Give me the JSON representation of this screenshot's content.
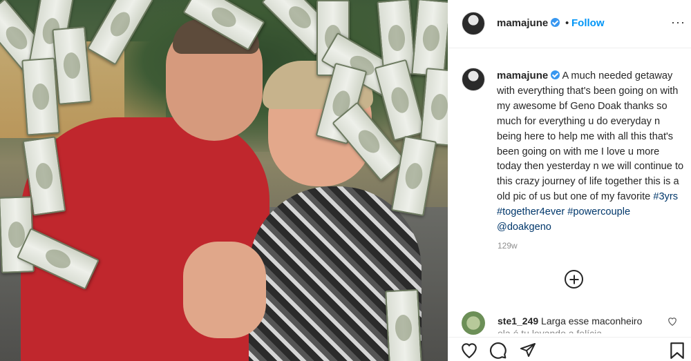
{
  "post": {
    "username": "mamajune",
    "follow_label": "Follow",
    "dot": "•",
    "more": "···",
    "caption": {
      "username": "mamajune",
      "text": " A much needed getaway with everything that's been going on with my awesome bf Geno Doak thanks so much for everything u do everyday n being here to help me with all this that's been going on with me I love u more today then yesterday n we will continue to this crazy journey of life together this is a old pic of us but one of my favorite ",
      "tags": [
        "#3yrs",
        "#together4ever",
        "#powercouple",
        "@doakgeno"
      ]
    },
    "timestamp": "129w"
  },
  "comment": {
    "username": "ste1_249",
    "text": " Larga esse maconheiro",
    "cut": "ela é tu levando a felícia"
  },
  "icons": {
    "verified": "verified-badge-icon",
    "more": "more-options-icon",
    "plus": "plus-circle-icon",
    "heart": "heart-icon",
    "comment": "comment-icon",
    "share": "share-icon",
    "save": "bookmark-icon"
  },
  "colors": {
    "link": "#0095f6",
    "tag": "#00376b",
    "muted": "#8e8e8e"
  }
}
